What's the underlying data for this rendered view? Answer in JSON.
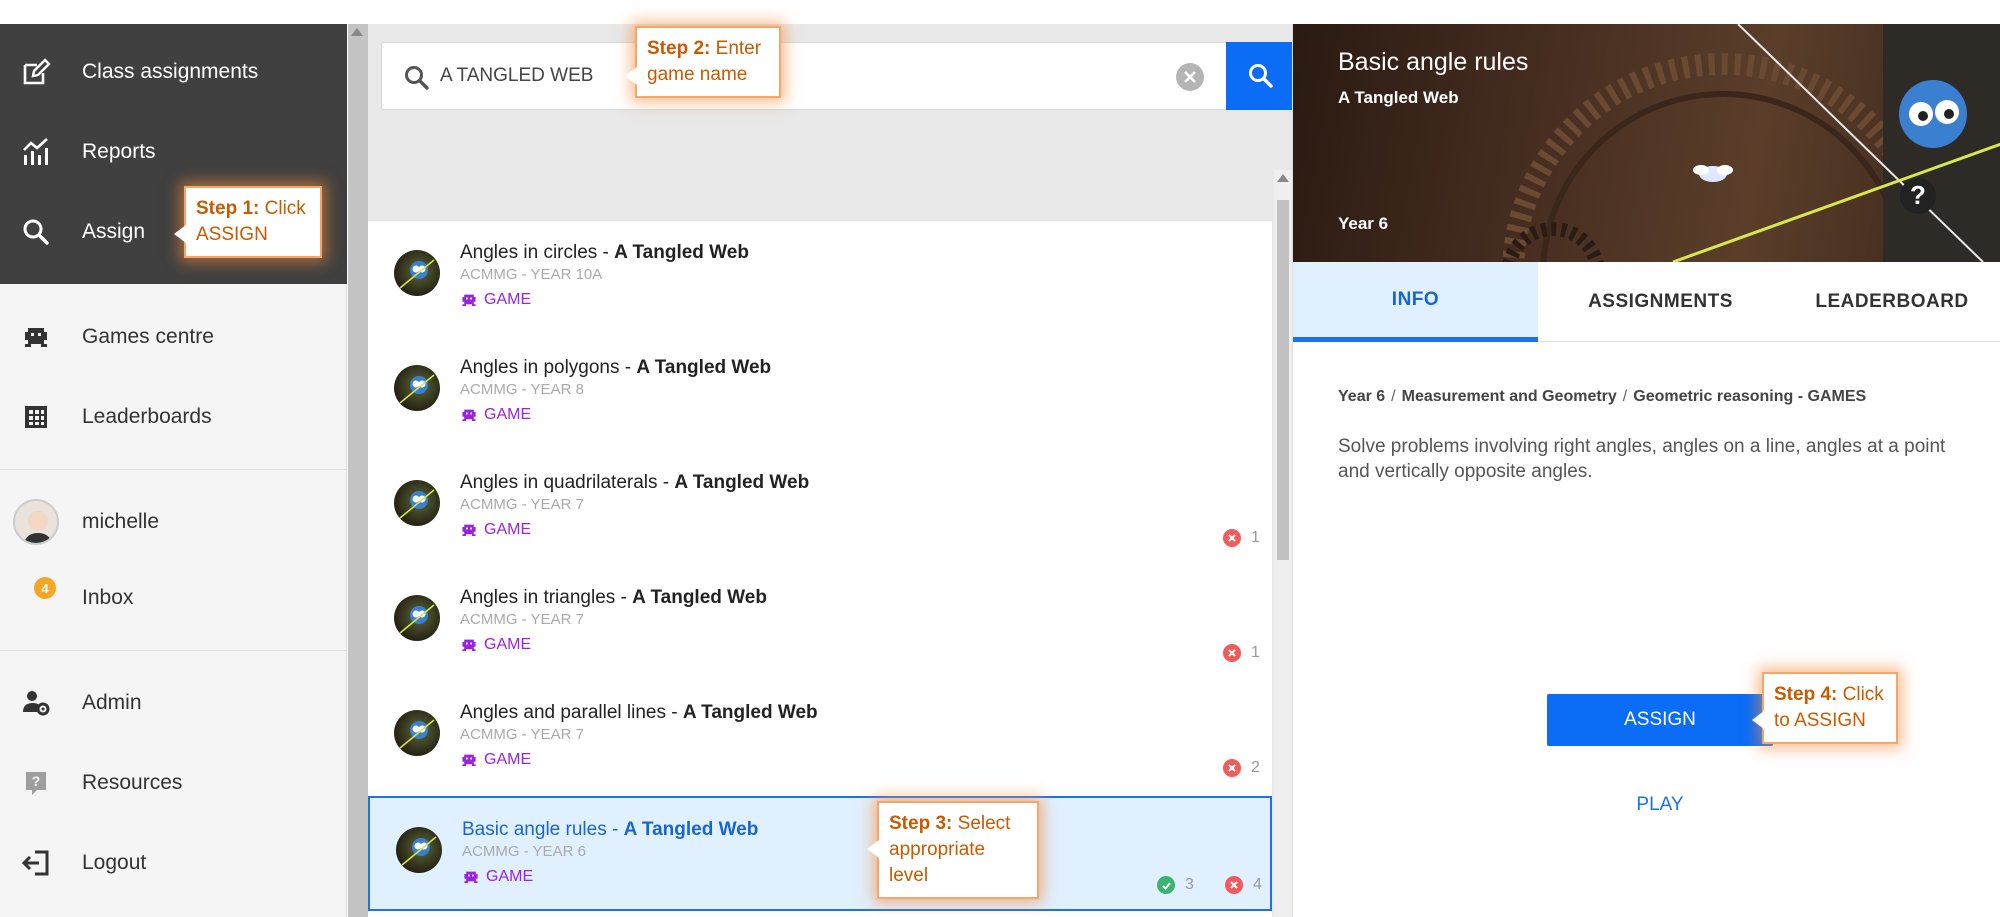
{
  "sidebar": {
    "items": [
      {
        "label": "Class assignments",
        "icon": "edit-icon"
      },
      {
        "label": "Reports",
        "icon": "chart-icon"
      },
      {
        "label": "Assign",
        "icon": "search-icon"
      },
      {
        "label": "Games centre",
        "icon": "game-icon"
      },
      {
        "label": "Leaderboards",
        "icon": "grid-icon"
      },
      {
        "label": "michelle",
        "icon": "avatar"
      },
      {
        "label": "Inbox",
        "icon": "inbox-badge"
      },
      {
        "label": "Admin",
        "icon": "admin-icon"
      },
      {
        "label": "Resources",
        "icon": "help-icon"
      },
      {
        "label": "Logout",
        "icon": "logout-icon"
      }
    ],
    "inbox_count": "4"
  },
  "search": {
    "value": "A TANGLED WEB"
  },
  "results": [
    {
      "topic": "Angles in circles",
      "separator": " - ",
      "game": "A Tangled Web",
      "sub": "ACMMG - YEAR 10A",
      "tag": "GAME",
      "stats": []
    },
    {
      "topic": "Angles in polygons",
      "separator": " - ",
      "game": "A Tangled Web",
      "sub": "ACMMG - YEAR 8",
      "tag": "GAME",
      "stats": []
    },
    {
      "topic": "Angles in quadrilaterals",
      "separator": " - ",
      "game": "A Tangled Web",
      "sub": "ACMMG - YEAR 7",
      "tag": "GAME",
      "stats": [
        {
          "kind": "fail",
          "count": "1"
        }
      ]
    },
    {
      "topic": "Angles in triangles",
      "separator": " - ",
      "game": "A Tangled Web",
      "sub": "ACMMG - YEAR 7",
      "tag": "GAME",
      "stats": [
        {
          "kind": "fail",
          "count": "1"
        }
      ]
    },
    {
      "topic": "Angles and parallel lines",
      "separator": " - ",
      "game": "A Tangled Web",
      "sub": "ACMMG - YEAR 7",
      "tag": "GAME",
      "stats": [
        {
          "kind": "fail",
          "count": "2"
        }
      ]
    },
    {
      "topic": "Basic angle rules",
      "separator": " - ",
      "game": "A Tangled Web",
      "sub": "ACMMG - YEAR 6",
      "tag": "GAME",
      "stats": [
        {
          "kind": "pass",
          "count": "3"
        },
        {
          "kind": "fail",
          "count": "4"
        }
      ],
      "selected": true
    }
  ],
  "detail": {
    "title": "Basic angle rules",
    "subtitle": "A Tangled Web",
    "year": "Year 6",
    "tabs": [
      "INFO",
      "ASSIGNMENTS",
      "LEADERBOARD"
    ],
    "active_tab": "INFO",
    "breadcrumb": [
      "Year 6",
      "Measurement and Geometry",
      "Geometric reasoning - GAMES"
    ],
    "description": "Solve problems involving right angles, angles on a line, angles at a point and vertically opposite angles.",
    "assign_label": "ASSIGN",
    "play_label": "PLAY"
  },
  "callouts": [
    {
      "step": "Step 1:",
      "text": "Click ASSIGN"
    },
    {
      "step": "Step 2:",
      "text": "Enter game name"
    },
    {
      "step": "Step 3:",
      "text": "Select appropriate level"
    },
    {
      "step": "Step 4:",
      "text": "Click to ASSIGN"
    }
  ],
  "colors": {
    "accent": "#0b6cf5",
    "sidebar_dark": "#404040",
    "game_tag": "#9b22e0",
    "callout_text": "#c85a00",
    "fail": "#f15b5b",
    "pass": "#3cb371"
  }
}
